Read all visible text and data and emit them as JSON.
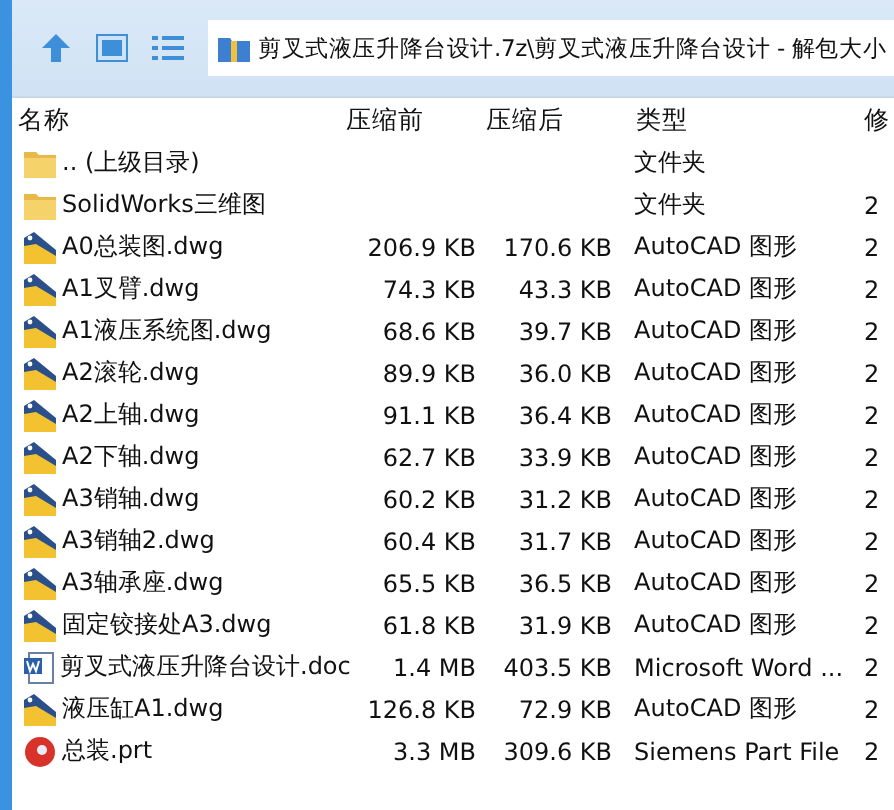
{
  "address_bar": {
    "path": "剪叉式液压升降台设计.7z\\剪叉式液压升降台设计 - 解包大小"
  },
  "table": {
    "columns": [
      "名称",
      "压缩前",
      "压缩后",
      "类型",
      "修"
    ],
    "rows": [
      {
        "kind": "folder",
        "name": ".. (上级目录)",
        "size": "",
        "packed": "",
        "type": "文件夹",
        "column_5": ""
      },
      {
        "kind": "folder",
        "name": "SolidWorks三维图",
        "size": "",
        "packed": "",
        "type": "文件夹",
        "column_5": "2"
      },
      {
        "kind": "dwg",
        "name": "A0总装图.dwg",
        "size": "206.9 KB",
        "packed": "170.6 KB",
        "type": "AutoCAD 图形",
        "column_5": "2"
      },
      {
        "kind": "dwg",
        "name": "A1叉臂.dwg",
        "size": "74.3 KB",
        "packed": "43.3 KB",
        "type": "AutoCAD 图形",
        "column_5": "2"
      },
      {
        "kind": "dwg",
        "name": "A1液压系统图.dwg",
        "size": "68.6 KB",
        "packed": "39.7 KB",
        "type": "AutoCAD 图形",
        "column_5": "2"
      },
      {
        "kind": "dwg",
        "name": "A2滚轮.dwg",
        "size": "89.9 KB",
        "packed": "36.0 KB",
        "type": "AutoCAD 图形",
        "column_5": "2"
      },
      {
        "kind": "dwg",
        "name": "A2上轴.dwg",
        "size": "91.1 KB",
        "packed": "36.4 KB",
        "type": "AutoCAD 图形",
        "column_5": "2"
      },
      {
        "kind": "dwg",
        "name": "A2下轴.dwg",
        "size": "62.7 KB",
        "packed": "33.9 KB",
        "type": "AutoCAD 图形",
        "column_5": "2"
      },
      {
        "kind": "dwg",
        "name": "A3销轴.dwg",
        "size": "60.2 KB",
        "packed": "31.2 KB",
        "type": "AutoCAD 图形",
        "column_5": "2"
      },
      {
        "kind": "dwg",
        "name": "A3销轴2.dwg",
        "size": "60.4 KB",
        "packed": "31.7 KB",
        "type": "AutoCAD 图形",
        "column_5": "2"
      },
      {
        "kind": "dwg",
        "name": "A3轴承座.dwg",
        "size": "65.5 KB",
        "packed": "36.5 KB",
        "type": "AutoCAD 图形",
        "column_5": "2"
      },
      {
        "kind": "dwg",
        "name": "固定铰接处A3.dwg",
        "size": "61.8 KB",
        "packed": "31.9 KB",
        "type": "AutoCAD 图形",
        "column_5": "2"
      },
      {
        "kind": "doc",
        "name": "剪叉式液压升降台设计.doc",
        "size": "1.4 MB",
        "packed": "403.5 KB",
        "type": "Microsoft Word ...",
        "column_5": "2"
      },
      {
        "kind": "dwg",
        "name": "液压缸A1.dwg",
        "size": "126.8 KB",
        "packed": "72.9 KB",
        "type": "AutoCAD 图形",
        "column_5": "2"
      },
      {
        "kind": "prt",
        "name": "总装.prt",
        "size": "3.3 MB",
        "packed": "309.6 KB",
        "type": "Siemens Part File",
        "column_5": "2"
      }
    ]
  }
}
